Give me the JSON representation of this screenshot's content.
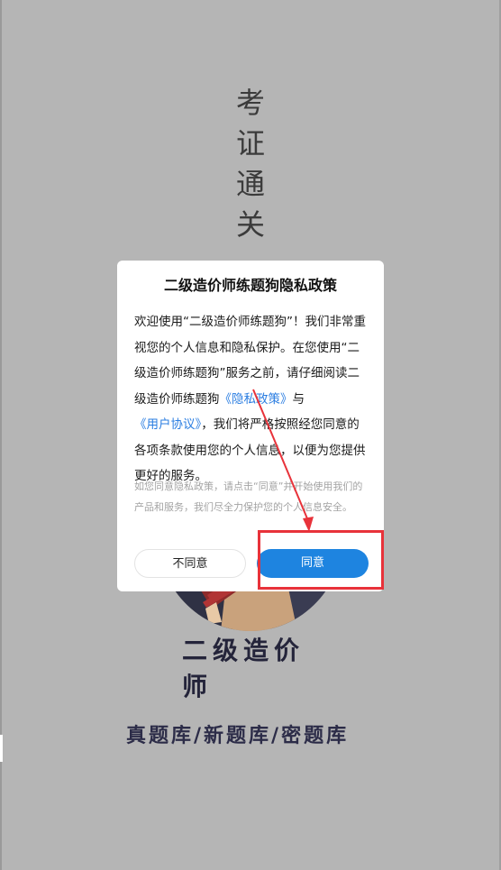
{
  "splash": {
    "title": "考证通关",
    "app_name": "二级造价师",
    "tagline": "真题库/新题库/密题库"
  },
  "dialog": {
    "title": "二级造价师练题狗隐私政策",
    "body_1": "欢迎使用“二级造价师练题狗”！我们非常重视您的个人信息和隐私保护。在您使用“二级造价师练题狗”服务之前，请仔细阅读二级造价师练题狗",
    "privacy_link": "《隐私政策》",
    "body_and": "与",
    "agreement_link": "《用户协议》",
    "body_2": "，我们将严格按照经您同意的各项条款使用您的个人信息，以便为您提供更好的服务。",
    "note": "如您同意隐私政策，请点击“同意”并开始使用我们的产品和服务，我们尽全力保护您的个人信息安全。",
    "disagree_label": "不同意",
    "agree_label": "同意"
  },
  "colors": {
    "overlay": "#b5b5b5",
    "accent": "#1e84e0",
    "link": "#2a7de1",
    "annotation": "#e8323a"
  }
}
